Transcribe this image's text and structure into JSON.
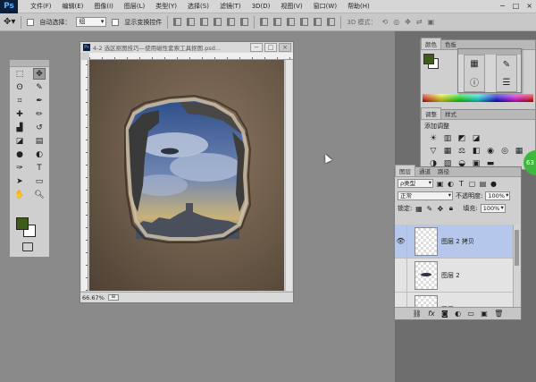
{
  "app": {
    "logo": "Ps"
  },
  "menubar": {
    "items": [
      "文件(F)",
      "编辑(E)",
      "图像(I)",
      "图层(L)",
      "类型(Y)",
      "选择(S)",
      "滤镜(T)",
      "3D(D)",
      "视图(V)",
      "窗口(W)",
      "帮助(H)"
    ],
    "window_controls": [
      "−",
      "□",
      "×"
    ]
  },
  "options_bar": {
    "auto_select_label": "自动选择：",
    "auto_select_value": "组",
    "show_transform_label": "显示变换控件",
    "mode_3d_label": "3D 模式："
  },
  "document": {
    "title": "4-2 选区抠图技巧—使用磁性套索工具抠图.psd...",
    "zoom": "66.67%",
    "colors": {
      "sky_top": "#2f4f8a",
      "sky_bottom": "#c9b27a",
      "paper": "#8a7560"
    }
  },
  "color_panel": {
    "tabs": [
      "颜色",
      "色板"
    ],
    "fg_color": "#3f5b1a",
    "bg_color": "#ffffff"
  },
  "adjustments_panel": {
    "tabs": [
      "调整",
      "样式"
    ],
    "title": "添加调整"
  },
  "layers_panel": {
    "tabs": [
      "图层",
      "通道",
      "路径"
    ],
    "filter_value": "ρ类型",
    "blend_mode": "正常",
    "opacity_label": "不透明度:",
    "opacity_value": "100%",
    "lock_label": "锁定:",
    "fill_label": "填充:",
    "fill_value": "100%",
    "layers": [
      {
        "name": "图层 2 拷贝",
        "visible": true,
        "selected": true
      },
      {
        "name": "图层 2",
        "visible": false,
        "selected": false
      },
      {
        "name": "图层",
        "visible": false,
        "selected": false
      }
    ]
  },
  "badge": {
    "text": "63"
  }
}
